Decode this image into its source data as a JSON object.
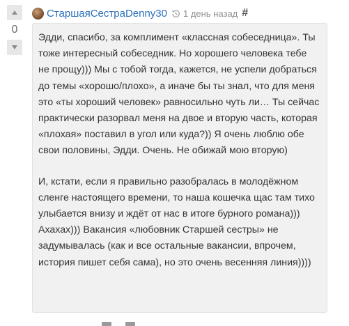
{
  "vote": {
    "score": "0",
    "up_icon": "triangle-up-icon",
    "down_icon": "triangle-down-icon"
  },
  "comment": {
    "avatar_icon": "user-avatar",
    "author": "СтаршаяСестраDenny30",
    "history_icon": "history-icon",
    "time": "1 день назад",
    "anchor": "#",
    "paragraphs": [
      "Эдди, спасибо, за комплимент «классная собеседница». Ты тоже интересный собеседник. Но хорошего человека тебе не прощу))) Мы с тобой тогда, кажется, не успели добраться до темы «хорошо/плохо», а иначе бы ты знал, что для меня это «ты хороший человек» равносильно чуть ли… Ты сейчас практически разорвал меня на двое и вторую часть, которая «плохая» поставил в угол или куда?)) Я очень люблю обе свои половины, Эдди. Очень. Не обижай мою вторую)",
      "И, кстати, если я правильно разобралась в молодёжном сленге настоящего времени, то наша кошечка щас там тихо улыбается внизу и ждёт от нас в итоге бурного романа))) Ахахах))) Вакансия «любовник Старшей сестры» не задумывалась (как и все остальные вакансии, впрочем, история пишет себя сама), но это очень весенняя линия))))"
    ]
  },
  "colors": {
    "author_link": "#2a6fb8",
    "bubble_bg": "#f1f1f1",
    "text": "#333333",
    "muted": "#8f8f8f"
  }
}
